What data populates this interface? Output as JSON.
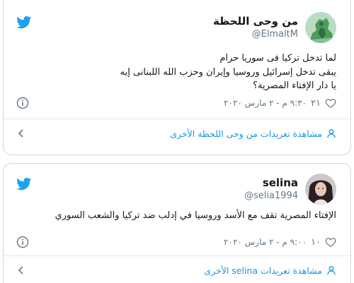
{
  "colors": {
    "accent": "#1da1f2",
    "link": "#1b95e0",
    "text": "#14171a",
    "muted": "#657786",
    "border": "#cfd9de"
  },
  "tweets": [
    {
      "display_name": "من وحى اللحظة",
      "handle": "@ElmaltM",
      "lines": [
        "لما تدخل تركيا فى سوريا حرام",
        "يبقى تدخل إسرائيل وروسيا وإيران وحزب الله اللبنانى إيه",
        "يا دار الإفتاء المصرية؟"
      ],
      "likes": "٢١",
      "timestamp": "٩:٣٠ م - ٢ مارس ٢٠٢٠",
      "footer_link": "مشاهدة تغريدات من وحى اللحظة الأخرى",
      "icons": {
        "brand": "twitter-bird-icon",
        "info": "info-icon",
        "like": "heart-icon",
        "footer": "person-icon",
        "nav": "chevron-left-icon"
      }
    },
    {
      "display_name": "selina",
      "handle": "@selia1994",
      "lines": [
        "الإفتاء المصرية تقف مع الأسد وروسيا في إدلب ضد تركيا والشعب السوري"
      ],
      "likes": "١٠",
      "timestamp": "٩:٠٠ م - ٢ مارس ٢٠٢٠",
      "footer_link": "مشاهدة تغريدات selina الأخرى",
      "icons": {
        "brand": "twitter-bird-icon",
        "info": "info-icon",
        "like": "heart-icon",
        "footer": "person-icon",
        "nav": "chevron-left-icon"
      }
    }
  ]
}
